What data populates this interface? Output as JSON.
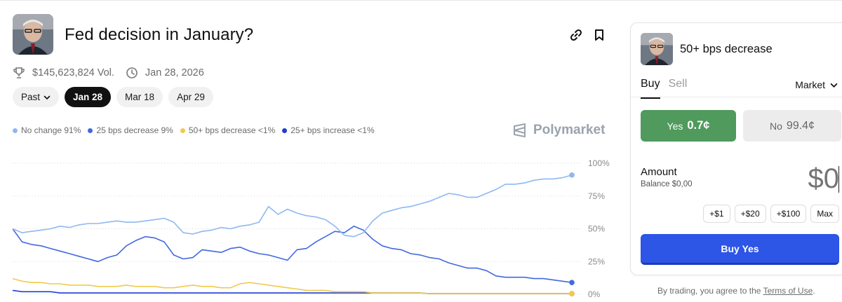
{
  "market": {
    "title": "Fed decision in January?",
    "volume": "$145,623,824 Vol.",
    "end_date": "Jan 28, 2026"
  },
  "header_icons": [
    "link-icon",
    "bookmark-icon"
  ],
  "date_tabs": [
    {
      "label": "Past",
      "active": false,
      "dropdown": true
    },
    {
      "label": "Jan 28",
      "active": true
    },
    {
      "label": "Mar 18",
      "active": false
    },
    {
      "label": "Apr 29",
      "active": false
    }
  ],
  "legend": [
    {
      "label": "No change 91%",
      "color": "#8fb8f2"
    },
    {
      "label": "25 bps decrease 9%",
      "color": "#4169e1"
    },
    {
      "label": "50+ bps decrease <1%",
      "color": "#f2c94c"
    },
    {
      "label": "25+ bps increase <1%",
      "color": "#1f3fd1"
    }
  ],
  "brand": "Polymarket",
  "chart_data": {
    "type": "line",
    "yticks": [
      "100%",
      "75%",
      "50%",
      "25%",
      "0%"
    ],
    "ylim": [
      0,
      100
    ],
    "grid": true,
    "series": [
      {
        "name": "No change",
        "color": "#8fb8f2",
        "values": [
          50,
          47,
          48,
          49,
          50,
          52,
          51,
          53,
          54,
          54,
          55,
          56,
          55,
          55,
          56,
          57,
          58,
          55,
          47,
          46,
          48,
          49,
          51,
          50,
          52,
          53,
          55,
          67,
          61,
          65,
          62,
          60,
          59,
          57,
          52,
          45,
          44,
          47,
          56,
          62,
          64,
          66,
          67,
          69,
          71,
          74,
          77,
          76,
          74,
          74,
          77,
          80,
          84,
          84,
          85,
          87,
          88,
          88,
          89,
          91
        ]
      },
      {
        "name": "25 bps decrease",
        "color": "#4169e1",
        "values": [
          50,
          40,
          38,
          37,
          35,
          33,
          31,
          29,
          27,
          25,
          28,
          30,
          37,
          41,
          44,
          43,
          40,
          30,
          27,
          28,
          34,
          33,
          32,
          35,
          36,
          33,
          31,
          30,
          28,
          26,
          34,
          35,
          40,
          44,
          48,
          47,
          52,
          49,
          42,
          37,
          35,
          34,
          31,
          30,
          28,
          27,
          24,
          22,
          20,
          20,
          18,
          14,
          13,
          13,
          13,
          12,
          12,
          11,
          10,
          9
        ]
      },
      {
        "name": "50+ bps decrease",
        "color": "#f2c94c",
        "values": [
          12,
          10,
          9,
          9,
          8,
          8,
          7,
          7,
          7,
          6,
          6,
          6,
          7,
          6,
          6,
          6,
          5,
          5,
          6,
          7,
          6,
          6,
          5,
          5,
          8,
          9,
          8,
          7,
          6,
          5,
          4,
          3,
          3,
          3,
          2,
          2,
          2,
          2,
          1,
          1,
          1,
          1,
          1,
          1,
          0.5,
          0.5,
          0.5,
          0.5,
          0.5,
          0.5,
          0.5,
          0.5,
          0.5,
          0.5,
          0.5,
          0.5,
          0.5,
          0.5,
          0.5,
          0.5
        ]
      },
      {
        "name": "25+ bps increase",
        "color": "#1f3fd1",
        "values": [
          3,
          2,
          2,
          2,
          2,
          1,
          1,
          1,
          1,
          1,
          1,
          1,
          1,
          1,
          1,
          1,
          1,
          1,
          1,
          1,
          1,
          1,
          1,
          1,
          1,
          1,
          1,
          1,
          1,
          1,
          1,
          1,
          1,
          1,
          1,
          1,
          1,
          1,
          1,
          1,
          1,
          1,
          1,
          1,
          0.5,
          0.5,
          0.5,
          0.5,
          0.5,
          0.5,
          0.5,
          0.5,
          0.5,
          0.5,
          0.5,
          0.5,
          0.5,
          0.5,
          0.5,
          0.5
        ]
      }
    ]
  },
  "trade": {
    "outcome": "50+ bps decrease",
    "buy_label": "Buy",
    "sell_label": "Sell",
    "order_type": "Market",
    "yes_label": "Yes",
    "yes_price": "0.7¢",
    "no_label": "No",
    "no_price": "99.4¢",
    "amount_label": "Amount",
    "balance": "Balance $0,00",
    "amount_value": "$0",
    "quick_amounts": [
      "+$1",
      "+$20",
      "+$100",
      "Max"
    ],
    "submit_label": "Buy Yes",
    "colors": {
      "yes": "#4f9a5c",
      "submit": "#2d55e6"
    }
  },
  "terms": {
    "prefix": "By trading, you agree to the",
    "link": "Terms of Use",
    "suffix": "."
  }
}
